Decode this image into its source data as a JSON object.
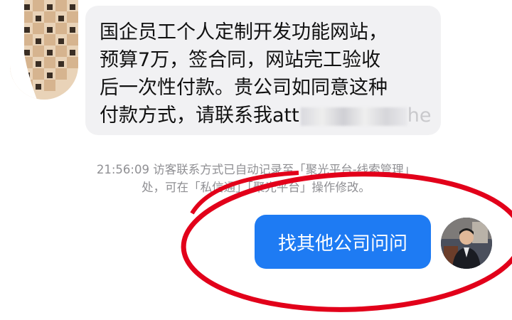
{
  "incoming": {
    "lines": [
      "国企员工个人定制开发功能网站，",
      "预算7万，签合同，网站完工验收",
      "后一次性付款。贵公司如同意这种"
    ],
    "last_line_prefix": "付款方式，请联系我att",
    "last_line_trail": "he"
  },
  "system_note": {
    "line1": "21:56:09 访客联系方式已自动记录至「聚光平台-线索管理」",
    "line2": "处，可在「私信通」「聚光平台」操作修改。"
  },
  "outgoing": {
    "text": "找其他公司问问"
  },
  "colors": {
    "outgoing_bubble": "#1e7bf3",
    "incoming_bubble": "#f1f1f3",
    "annotation_circle": "#e2001a"
  },
  "icons": {
    "left_avatar": "pixelated-avatar-icon",
    "right_avatar": "user-avatar-icon"
  }
}
